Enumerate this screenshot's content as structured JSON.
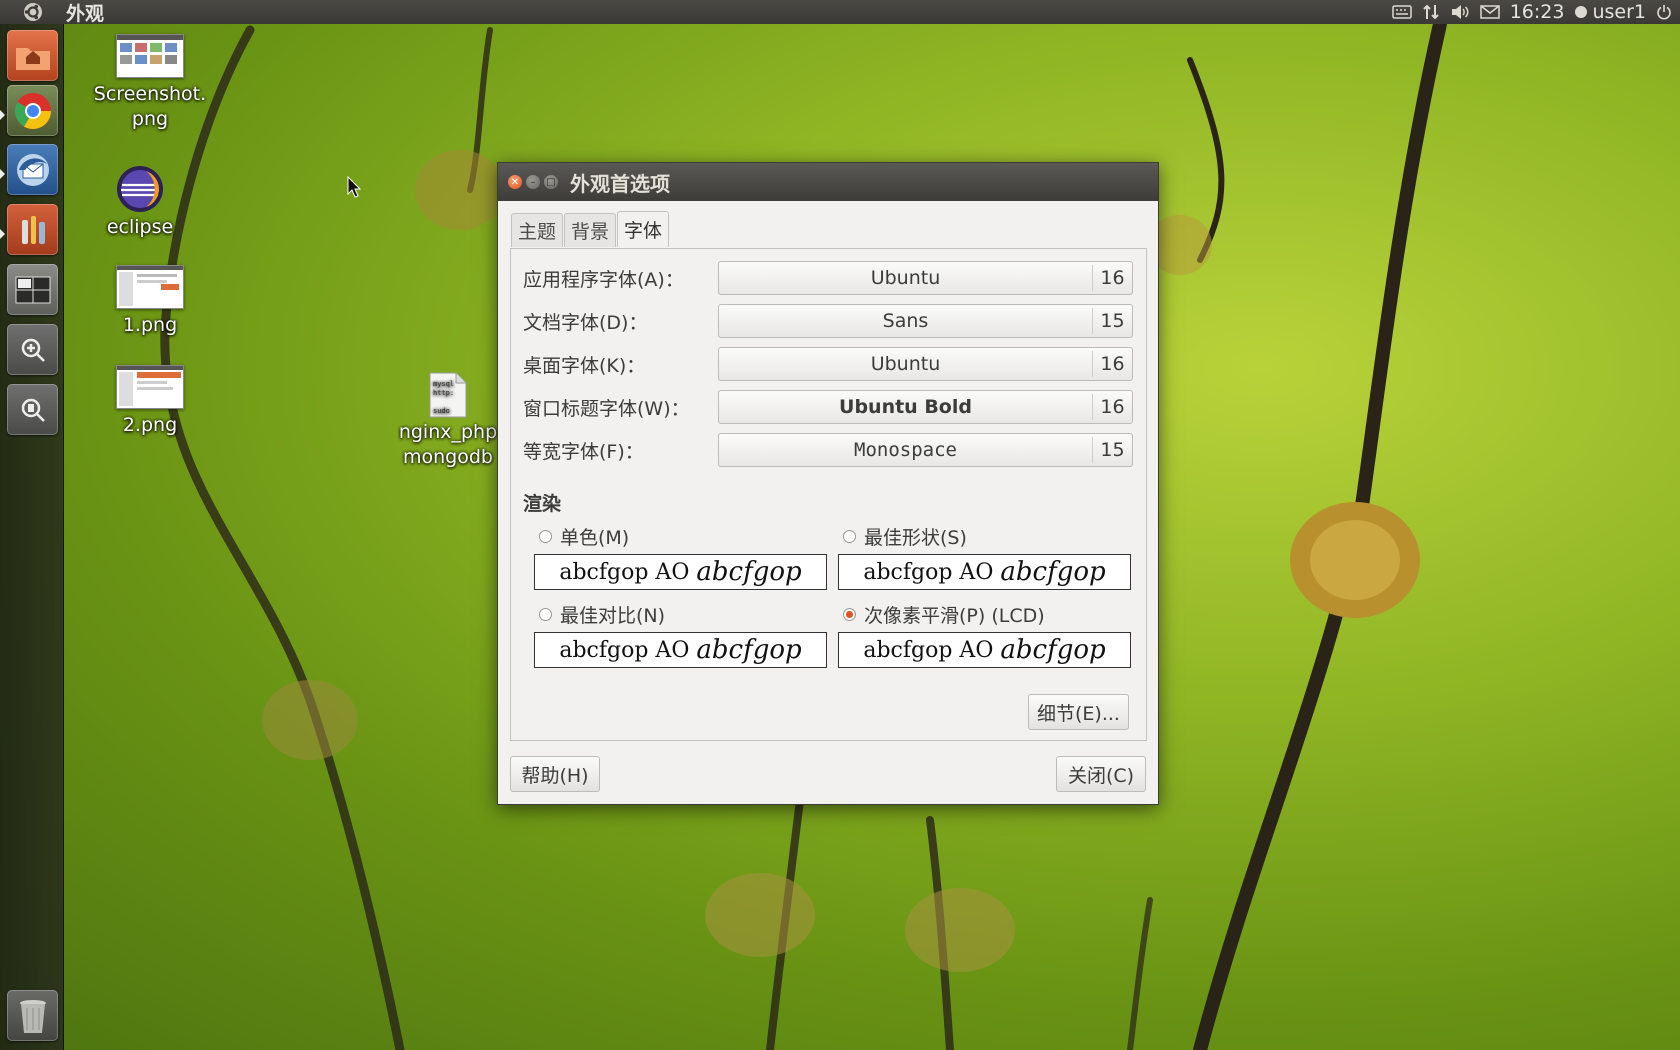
{
  "panel": {
    "app_title": "外观",
    "time": "16:23",
    "user": "user1"
  },
  "desktop_icons": [
    {
      "label": "Screenshot.\npng"
    },
    {
      "label": "eclipse"
    },
    {
      "label": "1.png"
    },
    {
      "label": "2.png"
    },
    {
      "label": "nginx_php mongodb"
    }
  ],
  "dialog": {
    "title": "外观首选项",
    "tabs": [
      {
        "label": "主题"
      },
      {
        "label": "背景"
      },
      {
        "label": "字体"
      }
    ],
    "fonts": [
      {
        "label": "应用程序字体(A)：",
        "font": "Ubuntu",
        "size": "16"
      },
      {
        "label": "文档字体(D)：",
        "font": "Sans",
        "size": "15"
      },
      {
        "label": "桌面字体(K)：",
        "font": "Ubuntu",
        "size": "16"
      },
      {
        "label": "窗口标题字体(W)：",
        "font": "Ubuntu Bold",
        "size": "16"
      },
      {
        "label": "等宽字体(F)：",
        "font": "Monospace",
        "size": "15"
      }
    ],
    "rendering": {
      "heading": "渲染",
      "options": [
        {
          "label": "单色(M)",
          "selected": false
        },
        {
          "label": "最佳形状(S)",
          "selected": false
        },
        {
          "label": "最佳对比(N)",
          "selected": false
        },
        {
          "label": "次像素平滑(P) (LCD)",
          "selected": true
        }
      ],
      "sample_text": "abcfgop AO",
      "sample_italic": "abcfgop"
    },
    "details_button": "细节(E)...",
    "help_button": "帮助(H)",
    "close_button": "关闭(C)"
  },
  "colors": {
    "accent": "#e0541f",
    "panel_bg": "#3c3b37",
    "dialog_bg": "#f2f1f0"
  }
}
